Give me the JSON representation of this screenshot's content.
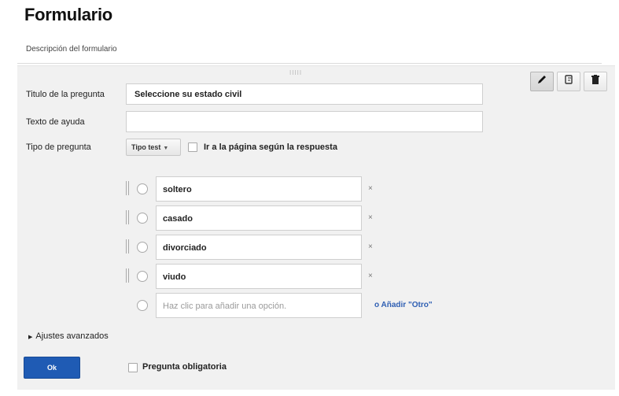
{
  "form": {
    "title": "Formulario",
    "description": "Descripción del formulario"
  },
  "editor": {
    "drag_handle": "IIIII",
    "toolbar": {
      "edit_icon": "pencil-icon",
      "duplicate_icon": "copy-icon",
      "delete_icon": "trash-icon"
    },
    "question_title_label": "Titulo de la pregunta",
    "question_title_value": "Seleccione su estado civil",
    "help_text_label": "Texto de ayuda",
    "help_text_value": "",
    "question_type_label": "Tipo de pregunta",
    "question_type_value": "Tipo test",
    "jump_label": "Ir a la página según la respuesta",
    "options": [
      {
        "value": "soltero",
        "remove": "×"
      },
      {
        "value": "casado",
        "remove": "×"
      },
      {
        "value": "divorciado",
        "remove": "×"
      },
      {
        "value": "viudo",
        "remove": "×"
      }
    ],
    "add_option_placeholder": "Haz clic para añadir una opción.",
    "add_other": "o Añadir \"Otro\"",
    "advanced_settings": "Ajustes avanzados",
    "ok_button": "Ok",
    "required_label": "Pregunta obligatoria"
  },
  "colors": {
    "accent": "#1f5bb4",
    "link": "#2f5fb3",
    "panel_bg": "#f1f1f1"
  }
}
